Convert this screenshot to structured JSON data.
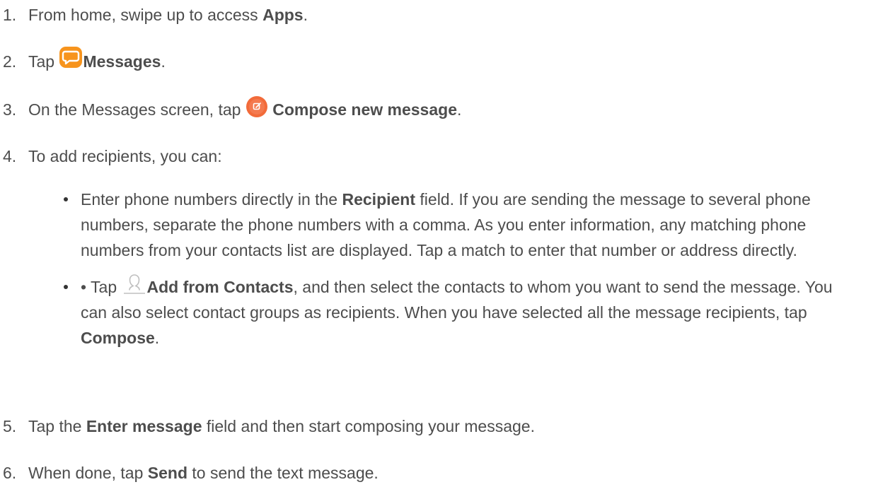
{
  "steps": [
    {
      "num": "1.",
      "pre": "From home, swipe up to access ",
      "bold": "Apps",
      "post": "."
    },
    {
      "num": "2.",
      "pre": "Tap ",
      "icon": "messages-icon",
      "bold": "Messages",
      "post": "."
    },
    {
      "num": "3.",
      "pre": "On the Messages screen, tap ",
      "icon": "compose-icon",
      "bold": "Compose new message",
      "post": "."
    },
    {
      "num": "4.",
      "pre": "To add recipients, you can:"
    },
    {
      "num": "5.",
      "pre": "Tap the ",
      "bold": "Enter message",
      "post": " field and then start composing your message."
    },
    {
      "num": "6.",
      "pre": "When done, tap ",
      "bold": "Send",
      "post": " to send the text message."
    }
  ],
  "bullets": [
    {
      "pre": "Enter phone numbers directly in the ",
      "bold": "Recipient",
      "post": " field. If you are sending the message to several phone numbers, separate the phone numbers with a comma. As you enter information, any matching phone numbers from your contacts list are displayed. Tap a match to enter that number or address directly."
    },
    {
      "pre": "• Tap ",
      "icon": "add-contact-icon",
      "bold": "Add from Contacts",
      "mid": ", and then select the contacts to whom you want to send the message. You can also select contact groups as recipients. When you have selected all the message recipients, tap ",
      "bold2": "Compose",
      "post": "."
    }
  ],
  "colors": {
    "text": "#4d4d4d",
    "messages_icon": "#f7941d",
    "compose_icon": "#f26b3a",
    "contact_icon": "#bfbfbf"
  }
}
